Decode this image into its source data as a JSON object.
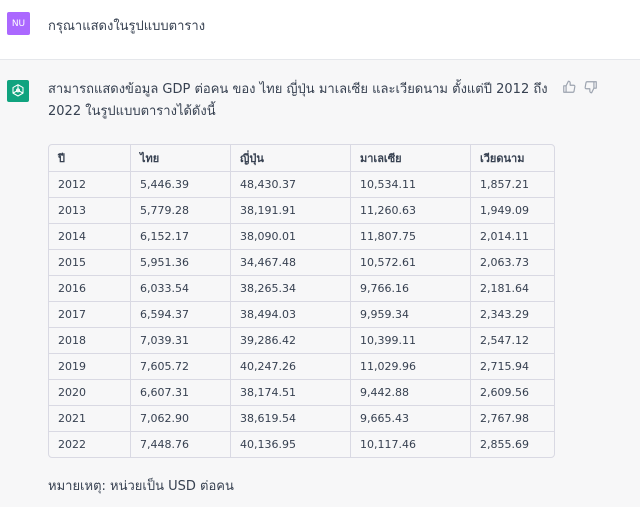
{
  "user": {
    "avatar_initials": "NU",
    "message": "กรุณาแสดงในรูปแบบตาราง"
  },
  "assistant": {
    "intro": "สามารถแสดงข้อมูล GDP ต่อคน ของ ไทย ญี่ปุ่น มาเลเซีย และเวียดนาม ตั้งแต่ปี 2012 ถึง 2022 ในรูปแบบตารางได้ดังนี้",
    "table": {
      "headers": [
        "ปี",
        "ไทย",
        "ญี่ปุ่น",
        "มาเลเซีย",
        "เวียดนาม"
      ],
      "rows": [
        [
          "2012",
          "5,446.39",
          "48,430.37",
          "10,534.11",
          "1,857.21"
        ],
        [
          "2013",
          "5,779.28",
          "38,191.91",
          "11,260.63",
          "1,949.09"
        ],
        [
          "2014",
          "6,152.17",
          "38,090.01",
          "11,807.75",
          "2,014.11"
        ],
        [
          "2015",
          "5,951.36",
          "34,467.48",
          "10,572.61",
          "2,063.73"
        ],
        [
          "2016",
          "6,033.54",
          "38,265.34",
          "9,766.16",
          "2,181.64"
        ],
        [
          "2017",
          "6,594.37",
          "38,494.03",
          "9,959.34",
          "2,343.29"
        ],
        [
          "2018",
          "7,039.31",
          "39,286.42",
          "10,399.11",
          "2,547.12"
        ],
        [
          "2019",
          "7,605.72",
          "40,247.26",
          "11,029.96",
          "2,715.94"
        ],
        [
          "2020",
          "6,607.31",
          "38,174.51",
          "9,442.88",
          "2,609.56"
        ],
        [
          "2021",
          "7,062.90",
          "38,619.54",
          "9,665.43",
          "2,767.98"
        ],
        [
          "2022",
          "7,448.76",
          "40,136.95",
          "10,117.46",
          "2,855.69"
        ]
      ]
    },
    "note": "หมายเหตุ: หน่วยเป็น USD ต่อคน",
    "icons": {
      "avatar": "openai-logo-icon",
      "like": "thumbs-up-icon",
      "dislike": "thumbs-down-icon"
    }
  },
  "colors": {
    "user_avatar_bg": "#ab68ff",
    "assistant_avatar_bg": "#10a37f",
    "assistant_bg": "#f7f7f8",
    "text": "#374151"
  }
}
